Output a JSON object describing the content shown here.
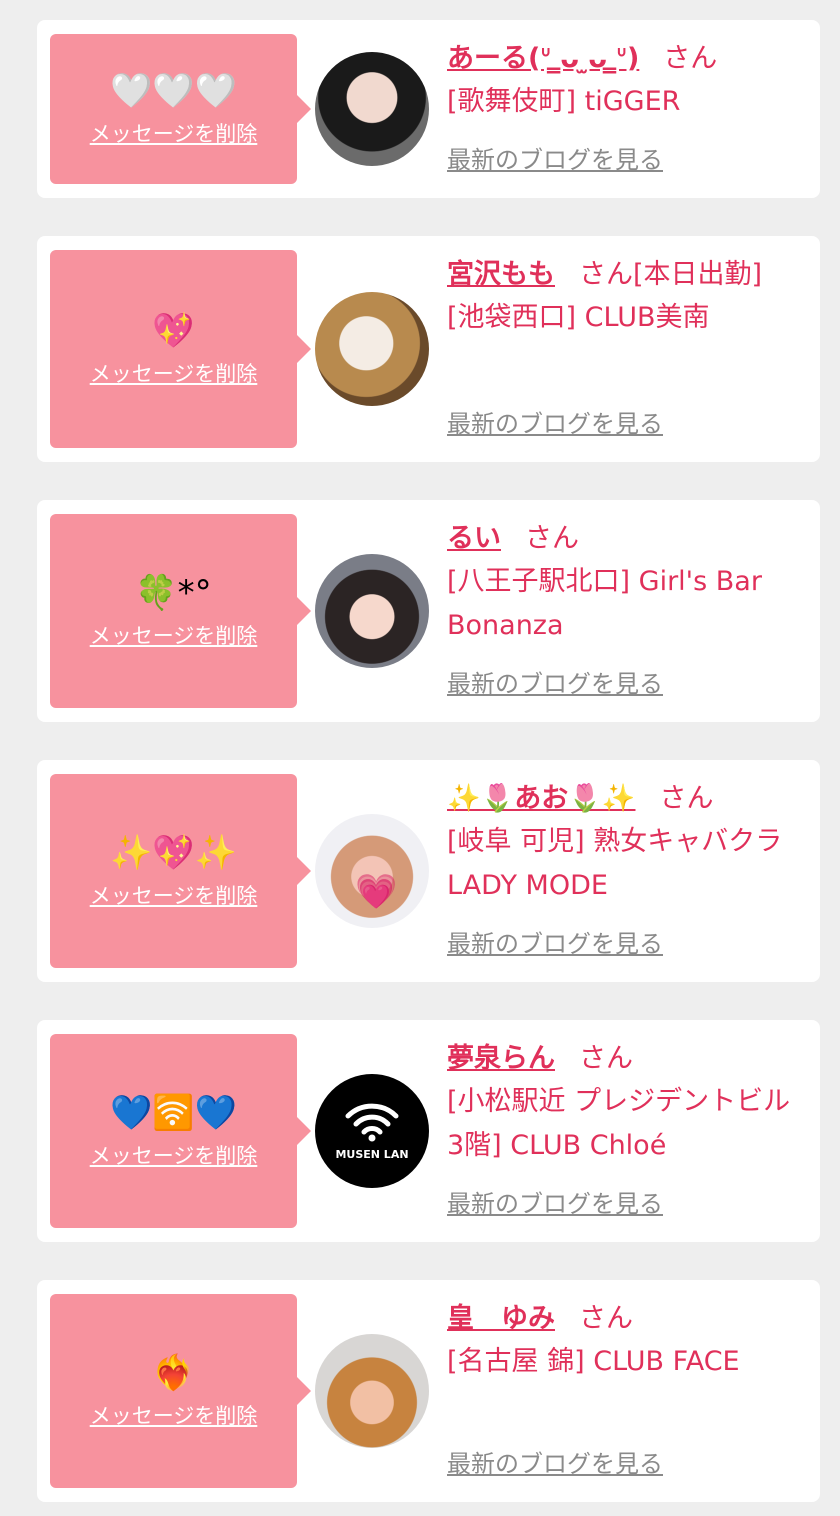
{
  "common": {
    "delete_label": "メッセージを削除",
    "san": "さん",
    "blog_label": "最新のブログを見る"
  },
  "cards": [
    {
      "message": "🤍🤍🤍",
      "name": "あーる(ᐡ ̳ᴗ ̫ᴗ ̳ᐡ)",
      "shop": "[歌舞伎町] tiGGER"
    },
    {
      "message": "💖",
      "name": "宮沢もも",
      "name_suffix": "[本日出勤]",
      "shop": "[池袋西口] CLUB美南"
    },
    {
      "message": "🍀*°",
      "name": "るい",
      "shop": "[八王子駅北口] Girl's Bar Bonanza"
    },
    {
      "message": "✨💖✨",
      "name": "✨🌷あお🌷✨",
      "shop": "[岐阜 可児] 熟女キャバクラ LADY MODE"
    },
    {
      "message": "💙🛜💙",
      "name": "夢泉らん",
      "shop": "[小松駅近 プレジデントビル3階] CLUB Chloé",
      "avatar_text": "MUSEN LAN"
    },
    {
      "message": "❤️‍🔥",
      "name": "皇　ゆみ",
      "shop": "[名古屋 錦] CLUB FACE"
    }
  ],
  "colors": {
    "accent": "#e0305a",
    "bubble": "#f7929e",
    "link_gray": "#8a8a8a",
    "background": "#eeeeee"
  }
}
